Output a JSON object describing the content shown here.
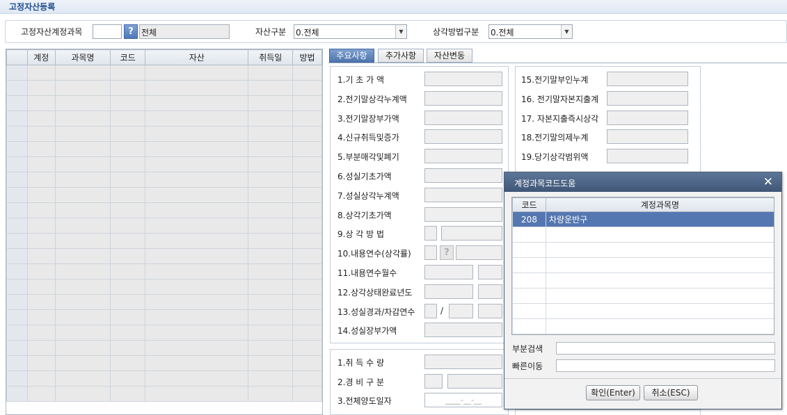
{
  "window": {
    "title": "고정자산등록"
  },
  "filters": {
    "account_label": "고정자산계정과목",
    "account_code": "",
    "account_name": "전체",
    "asset_type_label": "자산구분",
    "asset_type_value": "0.전체",
    "depreciation_label": "상각방법구분",
    "depreciation_value": "0.전체"
  },
  "grid": {
    "columns": [
      "계정",
      "과목명",
      "코드",
      "자산",
      "취득일",
      "방법"
    ],
    "row_count": 22
  },
  "tabs": [
    {
      "label": "주요사항",
      "active": true
    },
    {
      "label": "추가사항",
      "active": false
    },
    {
      "label": "자산변동",
      "active": false
    }
  ],
  "left_fields": [
    "1.기  초  가  액",
    "2.전기말상각누계액",
    "3.전기말장부가액",
    "4.신규취득및증가",
    "5.부분매각및폐기",
    "6.성실기초가액",
    "7.성실상각누계액",
    "8.상각기초가액",
    "9.상  각  방  법",
    "10.내용연수(상각률)",
    "11.내용연수월수",
    "12.상각상태완료년도",
    "13.성실경과/차감연수",
    "14.성실장부가액"
  ],
  "slash": "/",
  "right_fields": [
    "15.전기말부인누계",
    "16. 전기말자본지출계",
    "17. 자본지출즉시상각",
    "18.전기말의제누계",
    "19.당기상각범위액"
  ],
  "bottom_fields": [
    "1.취    득    수    량",
    "2.경    비    구    분",
    "3.전체양도일자"
  ],
  "date_placeholder": "____-__-__",
  "popup": {
    "title": "계정과목코드도움",
    "close": "✕",
    "col_code": "코드",
    "col_name": "계정과목명",
    "rows": [
      {
        "code": "208",
        "name": "차량운반구"
      }
    ],
    "search_label": "부분검색",
    "jump_label": "빠른이동",
    "ok": "확인(Enter)",
    "cancel": "취소(ESC)"
  }
}
